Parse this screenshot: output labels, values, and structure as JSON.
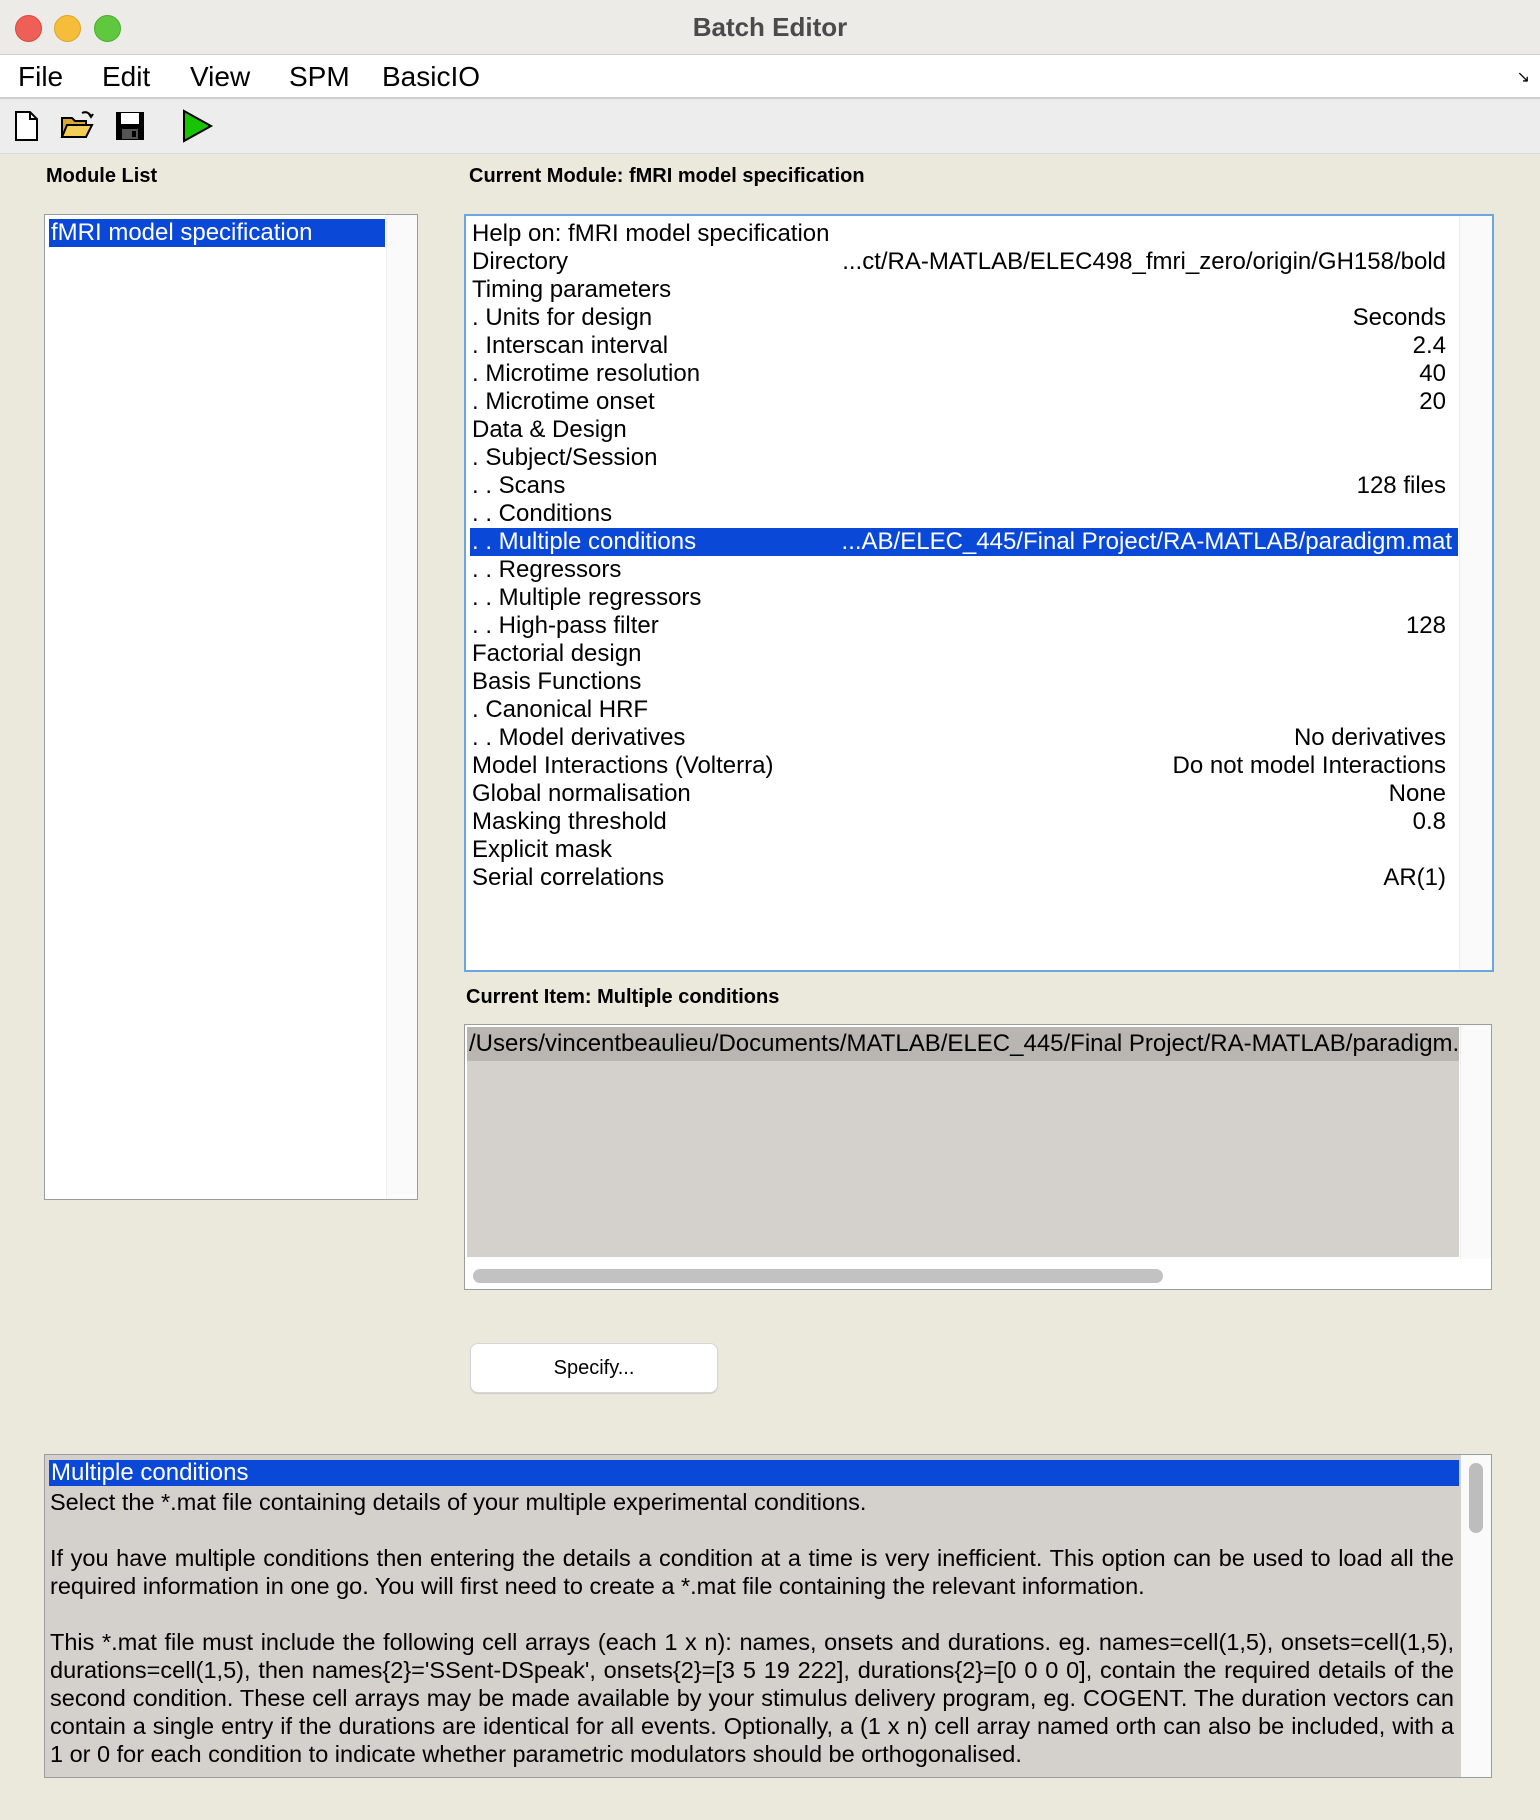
{
  "window": {
    "title": "Batch Editor"
  },
  "menu": [
    "File",
    "Edit",
    "View",
    "SPM",
    "BasicIO"
  ],
  "menu_corner_icon": "resize-arrow-icon",
  "toolbar": {
    "icons": [
      "new-file-icon",
      "open-folder-icon",
      "save-icon",
      "run-icon"
    ],
    "run_color": "#18c400"
  },
  "module_list": {
    "label": "Module List",
    "items": [
      "fMRI model specification"
    ]
  },
  "current_module": {
    "label": "Current Module: fMRI model specification",
    "rows": [
      {
        "name": "Help on: fMRI model specification",
        "value": ""
      },
      {
        "name": "Directory",
        "value": "...ct/RA-MATLAB/ELEC498_fmri_zero/origin/GH158/bold"
      },
      {
        "name": "Timing parameters",
        "value": ""
      },
      {
        "name": " . Units for design",
        "value": "Seconds"
      },
      {
        "name": " . Interscan interval",
        "value": "2.4"
      },
      {
        "name": " . Microtime resolution",
        "value": "40"
      },
      {
        "name": " . Microtime onset",
        "value": "20"
      },
      {
        "name": "Data & Design",
        "value": ""
      },
      {
        "name": " . Subject/Session",
        "value": ""
      },
      {
        "name": " . . Scans",
        "value": "128 files"
      },
      {
        "name": " . . Conditions",
        "value": ""
      },
      {
        "name": " . . Multiple conditions",
        "value": "...AB/ELEC_445/Final Project/RA-MATLAB/paradigm.mat"
      },
      {
        "name": " . . Regressors",
        "value": ""
      },
      {
        "name": " . . Multiple regressors",
        "value": ""
      },
      {
        "name": " . . High-pass filter",
        "value": "128"
      },
      {
        "name": "Factorial design",
        "value": ""
      },
      {
        "name": "Basis Functions",
        "value": ""
      },
      {
        "name": " . Canonical HRF",
        "value": ""
      },
      {
        "name": " . . Model derivatives",
        "value": "No derivatives"
      },
      {
        "name": "Model Interactions (Volterra)",
        "value": "Do not model Interactions"
      },
      {
        "name": "Global normalisation",
        "value": "None"
      },
      {
        "name": "Masking threshold",
        "value": "0.8"
      },
      {
        "name": "Explicit mask",
        "value": ""
      },
      {
        "name": "Serial correlations",
        "value": "AR(1)"
      }
    ],
    "selected_index": 11
  },
  "current_item": {
    "label": "Current Item: Multiple conditions",
    "value": "/Users/vincentbeaulieu/Documents/MATLAB/ELEC_445/Final Project/RA-MATLAB/paradigm.mat"
  },
  "specify_button": "Specify...",
  "help": {
    "title": "Multiple conditions",
    "paragraphs": [
      "Select the *.mat file containing details of your multiple experimental conditions.",
      "If you have multiple conditions then entering the details a condition at a time is very inefficient. This option can be used to load all the required information in one go. You will first need to create a *.mat file containing the relevant information.",
      "This *.mat file must include the following cell arrays (each 1 x n): names, onsets and durations. eg. names=cell(1,5), onsets=cell(1,5), durations=cell(1,5), then names{2}='SSent-DSpeak', onsets{2}=[3 5 19 222], durations{2}=[0 0 0 0], contain the required details of the second condition. These cell arrays may be made available by your stimulus delivery program, eg. COGENT. The duration vectors can contain a single entry if the durations are identical for all events. Optionally, a (1 x n) cell array named orth can also be included, with a 1 or 0 for each condition to indicate whether parametric modulators should be orthogonalised."
    ]
  },
  "colors": {
    "selection": "#0a49d8",
    "window_bg": "#ebe8dc",
    "readonly_bg": "#d4d0cb"
  }
}
